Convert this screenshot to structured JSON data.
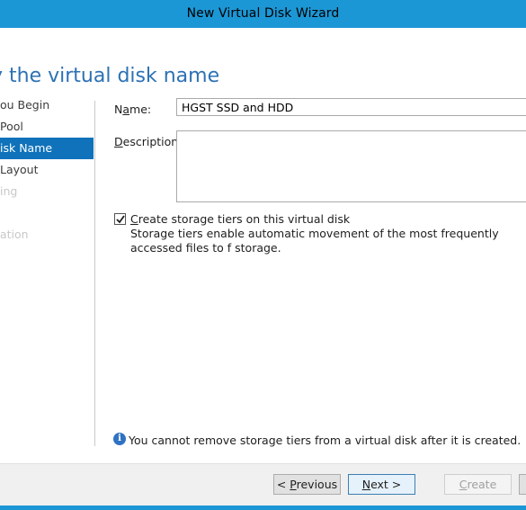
{
  "window": {
    "title": "New Virtual Disk Wizard"
  },
  "page": {
    "heading": "y the virtual disk name"
  },
  "nav": {
    "items": [
      {
        "label": "ou Begin",
        "state": "normal"
      },
      {
        "label": "Pool",
        "state": "normal"
      },
      {
        "label": "isk Name",
        "state": "active"
      },
      {
        "label": "Layout",
        "state": "normal"
      },
      {
        "label": "ing",
        "state": "disabled"
      },
      {
        "label": "ation",
        "state": "disabled"
      }
    ]
  },
  "form": {
    "name_label_pre": "N",
    "name_label_access": "a",
    "name_label_post": "me:",
    "name_value": "HGST SSD and HDD",
    "description_label_access": "D",
    "description_label_post": "escription:",
    "description_value": "",
    "tiers_checked": true,
    "tiers_label_access": "C",
    "tiers_label_post": "reate storage tiers on this virtual disk",
    "tiers_description": "Storage tiers enable automatic movement of the most frequently accessed files to f storage.",
    "info_text": "You cannot remove storage tiers from a virtual disk after it is created."
  },
  "buttons": {
    "previous_pre": "< ",
    "previous_access": "P",
    "previous_post": "revious",
    "next_access": "N",
    "next_post": "ext >",
    "create_access": "C",
    "create_post": "reate"
  },
  "colors": {
    "accent": "#1c97d5",
    "selection": "#0f72ba",
    "heading": "#2c71b5"
  }
}
